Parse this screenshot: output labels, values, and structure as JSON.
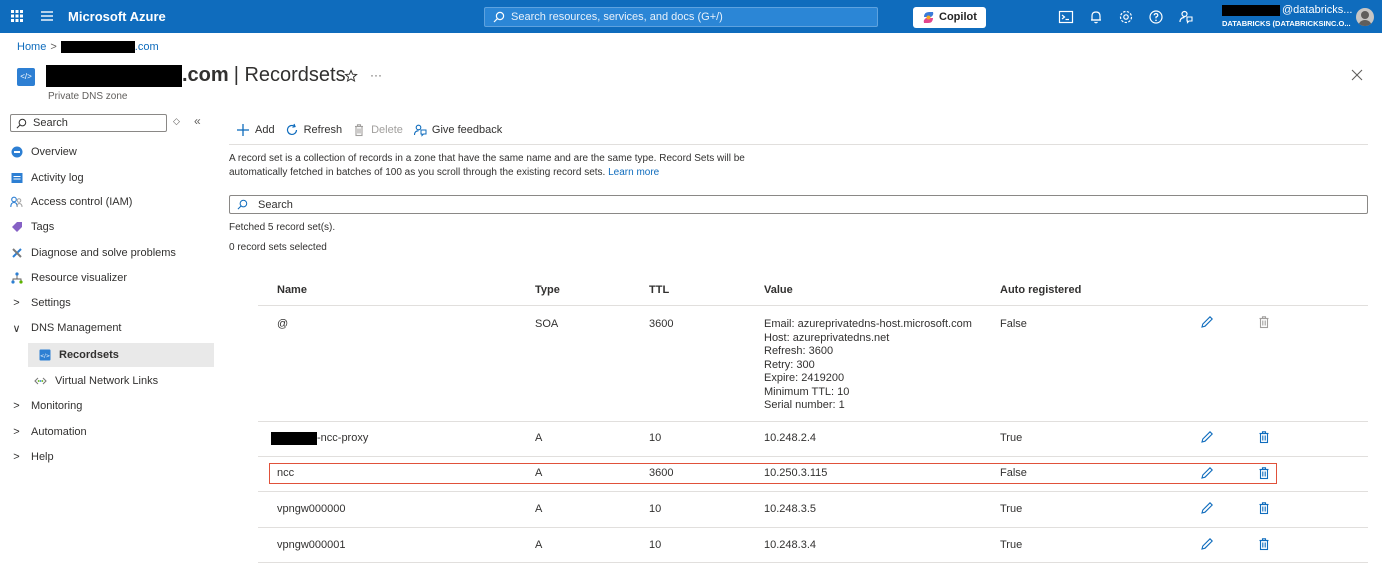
{
  "topbar": {
    "brand": "Microsoft Azure",
    "search_placeholder": "Search resources, services, and docs (G+/)",
    "copilot_label": "Copilot",
    "user_suffix": "@databricks...",
    "directory": "DATABRICKS (DATABRICKSINC.O...",
    "icons": [
      "waffle-icon",
      "menu-icon",
      "cloud-shell-icon",
      "bell-icon",
      "settings-icon",
      "help-icon",
      "feedback-icon"
    ]
  },
  "breadcrumb": {
    "home": "Home",
    "zone_suffix": ".com"
  },
  "header": {
    "title_suffix": ".com",
    "title_rest": "| Recordsets",
    "subtitle": "Private DNS zone",
    "more": "···"
  },
  "sidebar": {
    "search_placeholder": "Search",
    "items": [
      {
        "label": "Overview",
        "icon": "overview-icon"
      },
      {
        "label": "Activity log",
        "icon": "activity-log-icon"
      },
      {
        "label": "Access control (IAM)",
        "icon": "iam-icon"
      },
      {
        "label": "Tags",
        "icon": "tag-icon"
      },
      {
        "label": "Diagnose and solve problems",
        "icon": "diagnose-icon"
      },
      {
        "label": "Resource visualizer",
        "icon": "visualizer-icon"
      },
      {
        "label": "Settings",
        "icon": "chevron-right-icon"
      },
      {
        "label": "DNS Management",
        "icon": "chevron-down-icon"
      },
      {
        "label": "Recordsets",
        "icon": "recordsets-icon"
      },
      {
        "label": "Virtual Network Links",
        "icon": "vnet-link-icon"
      },
      {
        "label": "Monitoring",
        "icon": "chevron-right-icon"
      },
      {
        "label": "Automation",
        "icon": "chevron-right-icon"
      },
      {
        "label": "Help",
        "icon": "chevron-right-icon"
      }
    ]
  },
  "toolbar": {
    "add": "Add",
    "refresh": "Refresh",
    "delete": "Delete",
    "feedback": "Give feedback"
  },
  "description": {
    "text": "A record set is a collection of records in a zone that have the same name and are the same type. Record Sets will be automatically fetched in batches of 100 as you scroll through the existing record sets.",
    "link": "Learn more"
  },
  "search": {
    "placeholder": "Search"
  },
  "status": {
    "fetched": "Fetched 5 record set(s).",
    "selected": "0 record sets selected"
  },
  "table": {
    "columns": [
      "Name",
      "Type",
      "TTL",
      "Value",
      "Auto registered"
    ],
    "rows": [
      {
        "name": "@",
        "type": "SOA",
        "ttl": "3600",
        "value": [
          "Email: azureprivatedns-host.microsoft.com",
          "Host: azureprivatedns.net",
          "Refresh: 3600",
          "Retry: 300",
          "Expire: 2419200",
          "Minimum TTL: 10",
          "Serial number: 1"
        ],
        "auto": "False"
      },
      {
        "name": "-ncc-proxy",
        "type": "A",
        "ttl": "10",
        "value": [
          "10.248.2.4"
        ],
        "auto": "True"
      },
      {
        "name": "ncc",
        "type": "A",
        "ttl": "3600",
        "value": [
          "10.250.3.115"
        ],
        "auto": "False"
      },
      {
        "name": "vpngw000000",
        "type": "A",
        "ttl": "10",
        "value": [
          "10.248.3.5"
        ],
        "auto": "True"
      },
      {
        "name": "vpngw000001",
        "type": "A",
        "ttl": "10",
        "value": [
          "10.248.3.4"
        ],
        "auto": "True"
      }
    ]
  },
  "colors": {
    "topbar": "#0f6cbd",
    "link": "#0f6cbd",
    "highlight": "#e0513a",
    "action_icon": "#0f6cbd"
  }
}
